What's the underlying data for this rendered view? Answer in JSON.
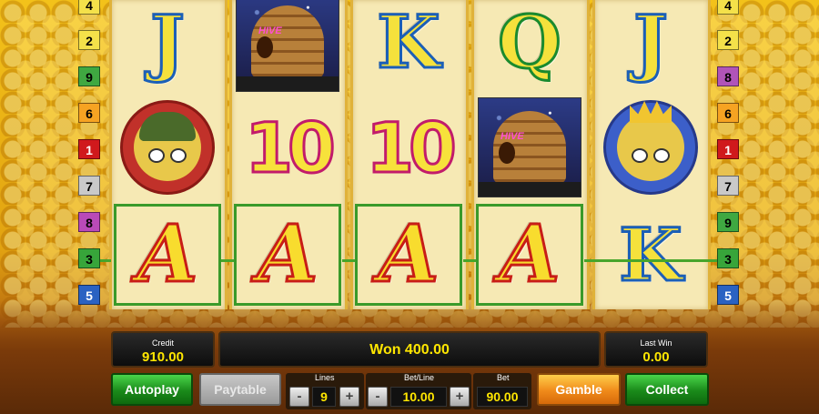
{
  "reels": [
    [
      "J",
      "soldier-bee",
      "A"
    ],
    [
      "beehive",
      "10",
      "A"
    ],
    [
      "K",
      "10",
      "A"
    ],
    [
      "Q",
      "beehive",
      "A"
    ],
    [
      "J",
      "king-bee",
      "K"
    ]
  ],
  "symbols": {
    "J": "J",
    "K": "K",
    "Q": "Q",
    "A": "A",
    "ten": "10",
    "hive_sign": "HIVE"
  },
  "left_lines": [
    "4",
    "2",
    "9",
    "6",
    "1",
    "7",
    "8",
    "3",
    "5"
  ],
  "right_lines": [
    "4",
    "2",
    "8",
    "6",
    "1",
    "7",
    "9",
    "3",
    "5"
  ],
  "panel": {
    "credit_label": "Credit",
    "credit_value": "910.00",
    "won_text": "Won 400.00",
    "last_win_label": "Last Win",
    "last_win_value": "0.00"
  },
  "controls": {
    "autoplay": "Autoplay",
    "paytable": "Paytable",
    "lines_label": "Lines",
    "lines_value": "9",
    "betline_label": "Bet/Line",
    "betline_value": "10.00",
    "bet_label": "Bet",
    "bet_value": "90.00",
    "minus": "-",
    "plus": "+",
    "gamble": "Gamble",
    "collect": "Collect"
  },
  "colors": {
    "win_line": "#48a52c",
    "value_yellow": "#ffe600"
  }
}
